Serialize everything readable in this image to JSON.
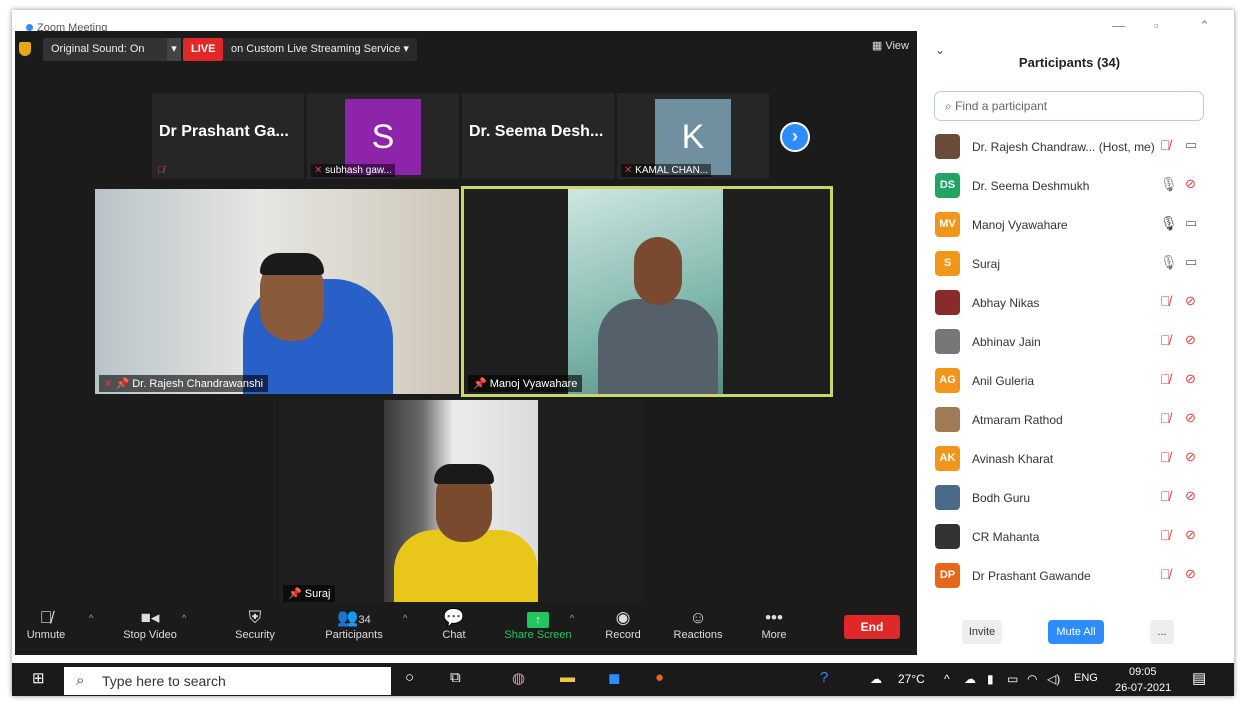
{
  "window": {
    "title": "Zoom Meeting"
  },
  "topbar": {
    "original_sound": "Original Sound: On",
    "live": "LIVE",
    "stream": "on Custom Live Streaming Service",
    "view": "View"
  },
  "strip": [
    {
      "name": "Dr Prashant Ga..."
    },
    {
      "avatar": "S",
      "label": "subhash gaw...",
      "color": "#8e24aa"
    },
    {
      "name": "Dr. Seema Desh..."
    },
    {
      "avatar": "K",
      "label": "KAMAL CHAN...",
      "color": "#7090a0"
    }
  ],
  "videos": [
    {
      "label": "Dr. Rajesh Chandrawanshi"
    },
    {
      "label": "Manoj Vyawahare"
    },
    {
      "label": "Suraj"
    }
  ],
  "toolbar": {
    "unmute": "Unmute",
    "stop_video": "Stop Video",
    "security": "Security",
    "participants": "Participants",
    "participants_count": "34",
    "chat": "Chat",
    "share_screen": "Share Screen",
    "record": "Record",
    "reactions": "Reactions",
    "more": "More",
    "end": "End"
  },
  "panel": {
    "title": "Participants (34)",
    "search_placeholder": "Find a participant",
    "participants": [
      {
        "name": "Dr. Rajesh Chandraw... (Host, me)",
        "initials": "",
        "color": "#6b4b3a",
        "mic": "muted",
        "cam": "on"
      },
      {
        "name": "Dr. Seema Deshmukh",
        "initials": "DS",
        "color": "#21a464",
        "mic": "on",
        "cam": "off"
      },
      {
        "name": "Manoj Vyawahare",
        "initials": "MV",
        "color": "#f29619",
        "mic": "talking",
        "cam": "on"
      },
      {
        "name": "Suraj",
        "initials": "S",
        "color": "#f29619",
        "mic": "on",
        "cam": "on"
      },
      {
        "name": "Abhay Nikas",
        "initials": "",
        "color": "#8a2b2b",
        "mic": "muted",
        "cam": "off"
      },
      {
        "name": "Abhinav Jain",
        "initials": "",
        "color": "#777777",
        "mic": "muted",
        "cam": "off"
      },
      {
        "name": "Anil Guleria",
        "initials": "AG",
        "color": "#f29619",
        "mic": "muted",
        "cam": "off"
      },
      {
        "name": "Atmaram Rathod",
        "initials": "",
        "color": "#a07a55",
        "mic": "muted",
        "cam": "off"
      },
      {
        "name": "Avinash Kharat",
        "initials": "AK",
        "color": "#f29619",
        "mic": "muted",
        "cam": "off"
      },
      {
        "name": "Bodh Guru",
        "initials": "",
        "color": "#4a6a8a",
        "mic": "muted",
        "cam": "off"
      },
      {
        "name": "CR Mahanta",
        "initials": "",
        "color": "#333333",
        "mic": "muted",
        "cam": "off"
      },
      {
        "name": "Dr Prashant Gawande",
        "initials": "DP",
        "color": "#e8661c",
        "mic": "muted",
        "cam": "off"
      }
    ],
    "invite": "Invite",
    "mute_all": "Mute All",
    "more": "..."
  },
  "taskbar": {
    "search_placeholder": "Type here to search",
    "weather": "27°C",
    "lang": "ENG",
    "time": "09:05",
    "date": "26-07-2021"
  }
}
